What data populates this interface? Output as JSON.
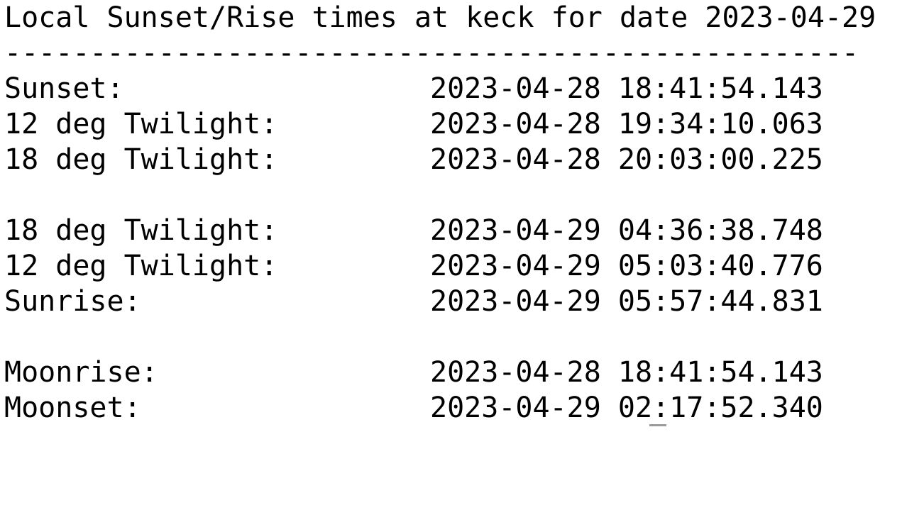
{
  "title": "Local Sunset/Rise times at keck for date 2023-04-29",
  "rule": "--------------------------------------------------",
  "evening": [
    {
      "label": "Sunset:",
      "value": "2023-04-28 18:41:54.143"
    },
    {
      "label": "12 deg Twilight:",
      "value": "2023-04-28 19:34:10.063"
    },
    {
      "label": "18 deg Twilight:",
      "value": "2023-04-28 20:03:00.225"
    }
  ],
  "morning": [
    {
      "label": "18 deg Twilight:",
      "value": "2023-04-29 04:36:38.748"
    },
    {
      "label": "12 deg Twilight:",
      "value": "2023-04-29 05:03:40.776"
    },
    {
      "label": "Sunrise:",
      "value": "2023-04-29 05:57:44.831"
    }
  ],
  "moon": [
    {
      "label": "Moonrise:",
      "value": "2023-04-28 18:41:54.143"
    },
    {
      "label": "Moonset:",
      "value": "2023-04-29 02:17:52.340"
    }
  ]
}
